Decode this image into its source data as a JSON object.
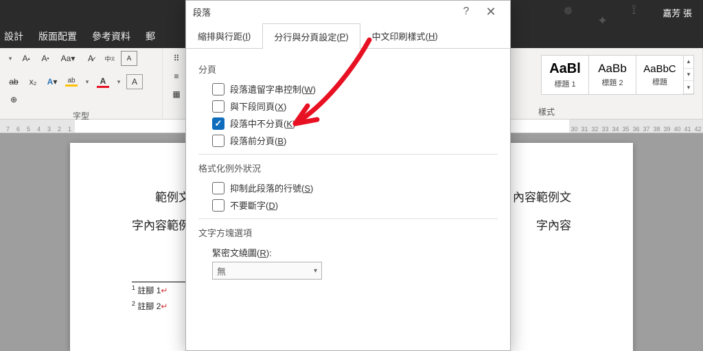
{
  "titlebar": {
    "username": "嘉芳 張"
  },
  "ribbonTabs": {
    "design": "設計",
    "layout": "版面配置",
    "references": "參考資料",
    "mail": "郵"
  },
  "ribbon": {
    "fontGroupLabel": "字型",
    "stylesGroupLabel": "樣式",
    "styles": [
      {
        "preview": "AaBl",
        "name": "標題 1"
      },
      {
        "preview": "AaBb",
        "name": "標題 2"
      },
      {
        "preview": "AaBbC",
        "name": "標題"
      }
    ]
  },
  "ruler": {
    "left": [
      "7",
      "6",
      "5",
      "4",
      "3",
      "2",
      "1"
    ],
    "right": [
      "30",
      "31",
      "32",
      "33",
      "34",
      "35",
      "36",
      "37",
      "38",
      "39",
      "40",
      "41",
      "42"
    ]
  },
  "document": {
    "line1": "範例文",
    "line1r": "內容範例文",
    "line2": "字內容範例",
    "line2r": "字內容",
    "footnote1": "註腳 1",
    "footnote2": "註腳 2",
    "fnMark": "↵"
  },
  "dialog": {
    "title": "段落",
    "tabs": {
      "indent": "縮排與行距(",
      "indent_u": "I",
      "indent_end": ")",
      "page": "分行與分頁設定(",
      "page_u": "P",
      "page_end": ")",
      "asian": "中文印刷樣式(",
      "asian_u": "H",
      "asian_end": ")"
    },
    "section_page": "分頁",
    "widow": "段落遺留字串控制(",
    "widow_u": "W",
    "widow_end": ")",
    "keepnext": "與下段同頁(",
    "keepnext_u": "X",
    "keepnext_end": ")",
    "keeplines": "段落中不分頁(",
    "keeplines_u": "K",
    "keeplines_end": ")",
    "pagebreak": "段落前分頁(",
    "pagebreak_u": "B",
    "pagebreak_end": ")",
    "section_fmt": "格式化例外狀況",
    "suppress": "抑制此段落的行號(",
    "suppress_u": "S",
    "suppress_end": ")",
    "nohyphen": "不要斷字(",
    "nohyphen_u": "D",
    "nohyphen_end": ")",
    "section_tbox": "文字方塊選項",
    "tightwrap": "緊密文繞圖(",
    "tightwrap_u": "R",
    "tightwrap_end": "):",
    "tightwrap_value": "無"
  }
}
